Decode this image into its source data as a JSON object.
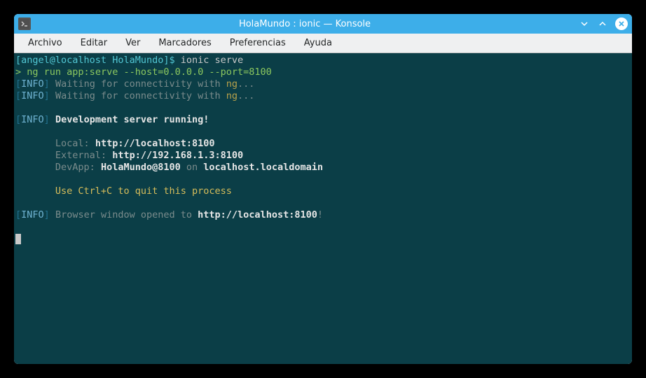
{
  "window": {
    "title": "HolaMundo : ionic — Konsole"
  },
  "menubar": {
    "items": [
      "Archivo",
      "Editar",
      "Ver",
      "Marcadores",
      "Preferencias",
      "Ayuda"
    ]
  },
  "terminal": {
    "prompt_user": "angel@localhost",
    "prompt_dir": "HolaMundo",
    "command": "ionic serve",
    "ng_line_prefix": ">",
    "ng_line": "ng run app:serve --host=0.0.0.0 --port=8100",
    "info_label": "INFO",
    "waiting_text": "Waiting for connectivity with",
    "waiting_target": "ng",
    "waiting_suffix": "...",
    "dev_server_running": "Development server running!",
    "local_label": "Local:",
    "local_url": "http://localhost:8100",
    "external_label": "External:",
    "external_url": "http://192.168.1.3:8100",
    "devapp_label": "DevApp:",
    "devapp_value": "HolaMundo@8100",
    "devapp_on": "on",
    "devapp_host": "localhost.localdomain",
    "quit_text": "Use Ctrl+C to quit this process",
    "browser_text_prefix": "Browser window opened to",
    "browser_url": "http://localhost:8100",
    "browser_suffix": "!"
  }
}
